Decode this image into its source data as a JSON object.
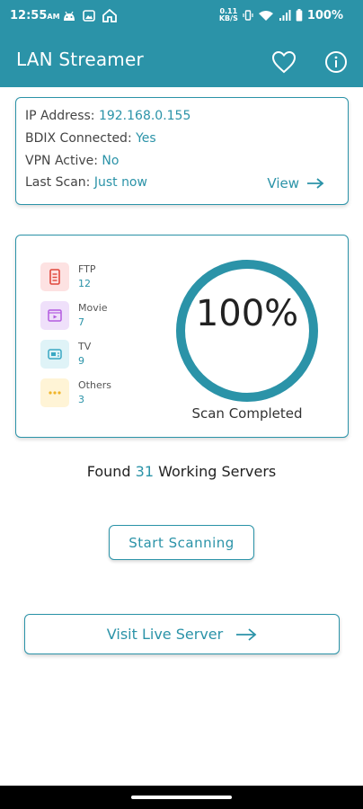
{
  "status": {
    "time": "12:55",
    "time_suffix": "AM",
    "net_speed_top": "0.11",
    "net_speed_bottom": "KB/S",
    "battery": "100%"
  },
  "appbar": {
    "title": "LAN Streamer",
    "favorite_icon": "heart-icon",
    "info_icon": "info-icon",
    "color": "#2b93a8"
  },
  "info_card": {
    "ip_label": "IP Address: ",
    "ip_value": "192.168.0.155",
    "bdix_label": "BDIX Connected: ",
    "bdix_value": "Yes",
    "vpn_label": "VPN Active: ",
    "vpn_value": "No",
    "scan_label": "Last Scan: ",
    "scan_value": "Just now",
    "view_label": "View"
  },
  "scan_card": {
    "categories": [
      {
        "name": "FTP",
        "count": "12",
        "icon": "ftp-icon",
        "bg": "#fde2e2",
        "fg": "#e0483c"
      },
      {
        "name": "Movie",
        "count": "7",
        "icon": "movie-icon",
        "bg": "#efe0fa",
        "fg": "#b35be0"
      },
      {
        "name": "TV",
        "count": "9",
        "icon": "tv-icon",
        "bg": "#dff3f7",
        "fg": "#3aa8c3"
      },
      {
        "name": "Others",
        "count": "3",
        "icon": "more-icon",
        "bg": "#fff4d6",
        "fg": "#f0b429"
      }
    ],
    "progress_text": "100%",
    "progress": 1.0,
    "caption": "Scan Completed"
  },
  "found": {
    "prefix": "Found ",
    "count": "31",
    "suffix": " Working Servers"
  },
  "buttons": {
    "start": "Start Scanning",
    "live": "Visit Live Server"
  }
}
